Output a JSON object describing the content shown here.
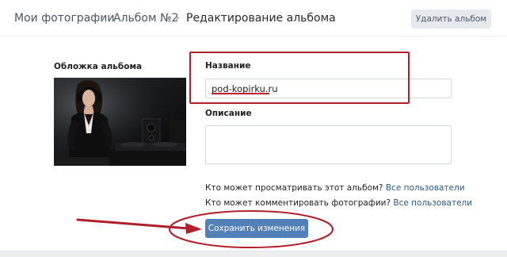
{
  "breadcrumb": {
    "items": [
      "Мои фотографии",
      "Альбом №2"
    ],
    "current": "Редактирование альбома",
    "separator": "›"
  },
  "actions": {
    "delete_label": "Удалить альбом",
    "save_label": "Сохранить изменения"
  },
  "cover": {
    "label": "Обложка альбома"
  },
  "form": {
    "name_label": "Название",
    "name_value": "pod-kopirku.ru",
    "description_label": "Описание",
    "description_value": ""
  },
  "privacy": {
    "view_question": "Кто может просматривать этот альбом?",
    "view_value": "Все пользователи",
    "comment_question": "Кто может комментировать фотографии?",
    "comment_value": "Все пользователи"
  },
  "colors": {
    "accent": "#5181b8",
    "link": "#2a5885",
    "annotation_red": "#b1202a"
  },
  "icons": [
    "chevron-right-icon",
    "annotation-arrow-icon"
  ]
}
